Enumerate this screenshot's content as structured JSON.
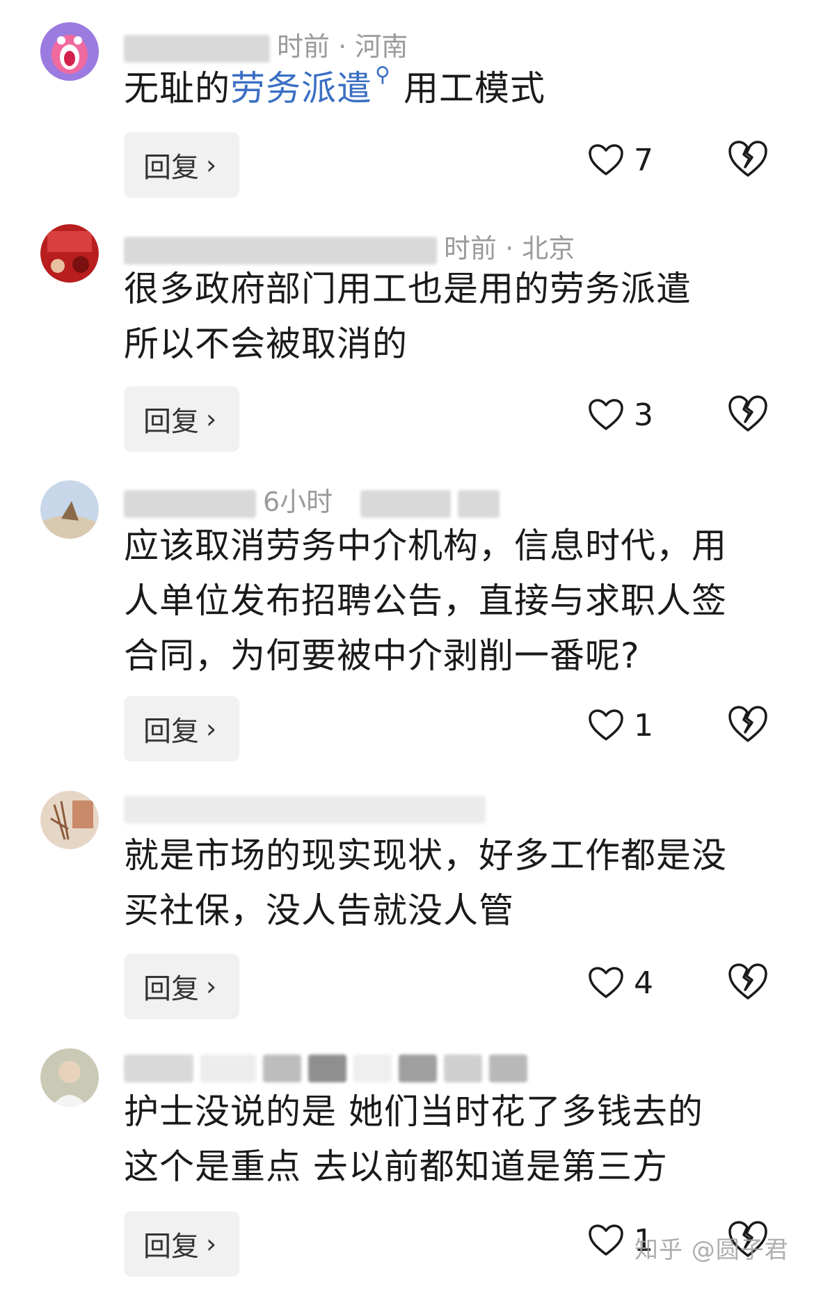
{
  "comments": [
    {
      "meta": "时前 · 河南",
      "text_parts": [
        "无耻的",
        "劳务派遣",
        "用工模式"
      ],
      "reply_label": "回复",
      "likes": "7"
    },
    {
      "meta": "时前 · 北京",
      "lines": [
        "很多政府部门用工也是用的劳务派遣",
        "所以不会被取消的"
      ],
      "reply_label": "回复",
      "likes": "3"
    },
    {
      "meta": "6小时",
      "lines": [
        "应该取消劳务中介机构，信息时代，用",
        "人单位发布招聘公告，直接与求职人签",
        "合同，为何要被中介剥削一番呢?"
      ],
      "reply_label": "回复",
      "likes": "1"
    },
    {
      "meta": "",
      "lines": [
        "就是市场的现实现状，好多工作都是没",
        "买社保，没人告就没人管"
      ],
      "reply_label": "回复",
      "likes": "4"
    },
    {
      "meta": "",
      "lines": [
        "护士没说的是 她们当时花了多钱去的",
        "这个是重点 去以前都知道是第三方"
      ],
      "reply_label": "回复",
      "likes": "1"
    }
  ],
  "watermark": "知乎 @圆子君",
  "colors": {
    "link": "#3b6fc4",
    "button_bg": "#f1f1f1",
    "meta_gray": "#9a9a9a"
  },
  "icons": [
    "search-icon",
    "chevron-right-icon",
    "heart-icon",
    "broken-heart-icon"
  ]
}
